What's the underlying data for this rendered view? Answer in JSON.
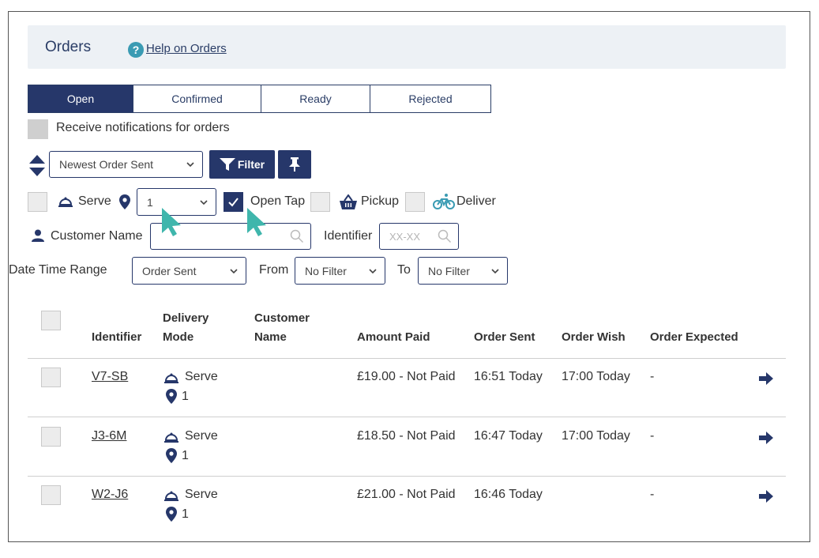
{
  "header": {
    "title": "Orders",
    "help_link": "Help on Orders"
  },
  "tabs": [
    {
      "label": "Open",
      "active": true
    },
    {
      "label": "Confirmed",
      "active": false
    },
    {
      "label": "Ready",
      "active": false
    },
    {
      "label": "Rejected",
      "active": false
    }
  ],
  "notifications": {
    "label": "Receive notifications for orders",
    "checked": false
  },
  "sort": {
    "selected": "Newest Order Sent",
    "filter_label": "Filter"
  },
  "modes": {
    "serve_label": "Serve",
    "table_selected": "1",
    "open_tap_label": "Open Tap",
    "open_tap_checked": true,
    "pickup_label": "Pickup",
    "deliver_label": "Deliver"
  },
  "search": {
    "customer_label": "Customer Name",
    "customer_value": "",
    "identifier_label": "Identifier",
    "identifier_placeholder": "XX-XX"
  },
  "date_range": {
    "label": "Date Time Range",
    "field_selected": "Order Sent",
    "from_label": "From",
    "from_selected": "No Filter",
    "to_label": "To",
    "to_selected": "No Filter"
  },
  "table": {
    "headers": {
      "identifier": "Identifier",
      "delivery_1": "Delivery",
      "delivery_2": "Mode",
      "customer_1": "Customer",
      "customer_2": "Name",
      "amount": "Amount Paid",
      "sent": "Order Sent",
      "wish": "Order Wish",
      "expected": "Order Expected"
    },
    "rows": [
      {
        "id": "V7-SB",
        "mode": "Serve",
        "table": "1",
        "customer": "",
        "amount": "£19.00 - Not Paid",
        "sent": "16:51 Today",
        "wish": "17:00 Today",
        "expected": "-"
      },
      {
        "id": "J3-6M",
        "mode": "Serve",
        "table": "1",
        "customer": "",
        "amount": "£18.50 - Not Paid",
        "sent": "16:47 Today",
        "wish": "17:00 Today",
        "expected": "-"
      },
      {
        "id": "W2-J6",
        "mode": "Serve",
        "table": "1",
        "customer": "",
        "amount": "£21.00 - Not Paid",
        "sent": "16:46 Today",
        "wish": "",
        "expected": "-"
      }
    ]
  },
  "colors": {
    "navy": "#26376a",
    "teal": "#3a9bb3",
    "panel": "#edf1f5",
    "cursor": "#3fb6ac"
  },
  "icons": [
    "help-icon",
    "sort-icon",
    "chevron-down-icon",
    "filter-icon",
    "pin-icon",
    "serve-icon",
    "location-pin-icon",
    "checkmark-icon",
    "basket-icon",
    "bicycle-icon",
    "person-icon",
    "search-icon",
    "arrow-right-icon",
    "mouse-pointer-icon"
  ]
}
